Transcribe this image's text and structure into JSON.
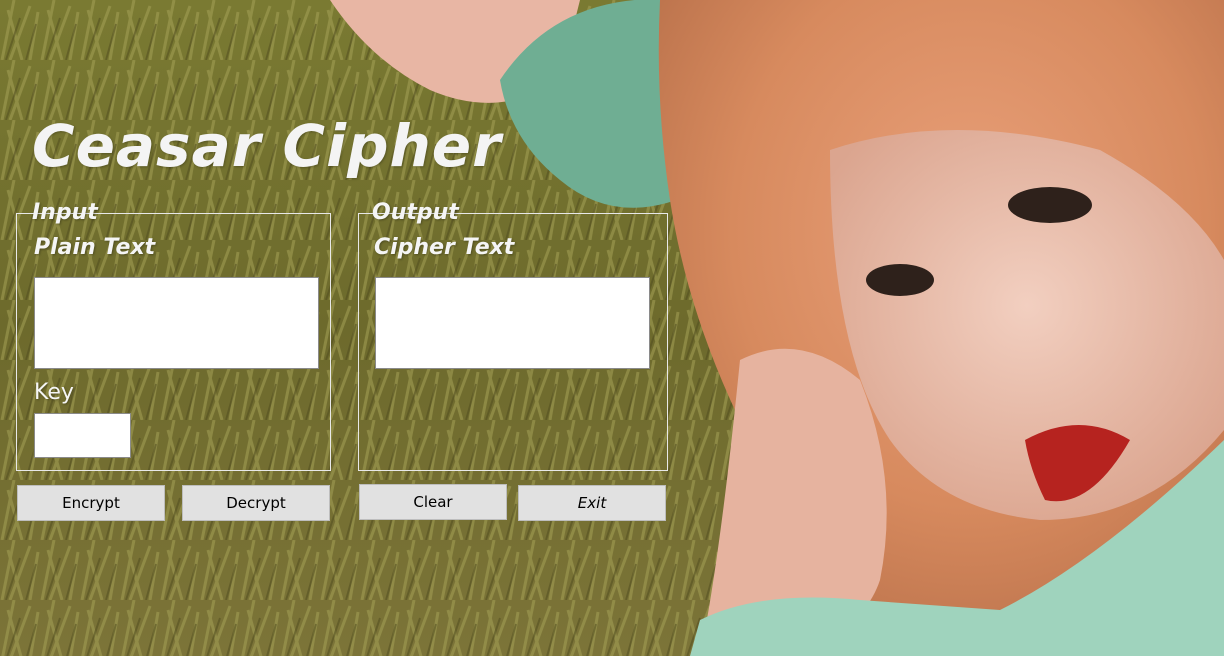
{
  "app": {
    "title": "Ceasar Cipher"
  },
  "input_group": {
    "legend": "Input",
    "plain_text_label": "Plain Text",
    "plain_text_value": "",
    "key_label": "Key",
    "key_value": ""
  },
  "output_group": {
    "legend": "Output",
    "cipher_text_label": "Cipher Text",
    "cipher_text_value": ""
  },
  "buttons": {
    "encrypt": "Encrypt",
    "decrypt": "Decrypt",
    "clear": "Clear",
    "exit": "Exit"
  }
}
